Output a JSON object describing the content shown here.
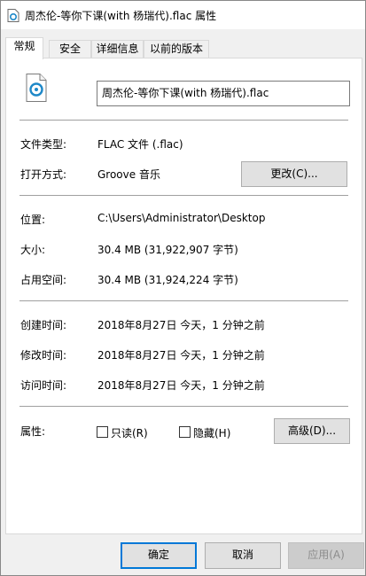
{
  "window": {
    "title": "周杰伦-等你下课(with 杨瑞代).flac 属性"
  },
  "tabs": [
    {
      "label": "常规"
    },
    {
      "label": "安全"
    },
    {
      "label": "详细信息"
    },
    {
      "label": "以前的版本"
    }
  ],
  "file": {
    "name": "周杰伦-等你下课(with 杨瑞代).flac",
    "icon": "music-file-icon"
  },
  "type": {
    "label": "文件类型:",
    "value": "FLAC 文件 (.flac)"
  },
  "open_with": {
    "label": "打开方式:",
    "value": "Groove 音乐",
    "button": "更改(C)..."
  },
  "location": {
    "label": "位置:",
    "value": "C:\\Users\\Administrator\\Desktop"
  },
  "size": {
    "label": "大小:",
    "value": "30.4 MB (31,922,907 字节)"
  },
  "size_on_disk": {
    "label": "占用空间:",
    "value": "30.4 MB (31,924,224 字节)"
  },
  "created": {
    "label": "创建时间:",
    "value": "2018年8月27日 今天，1 分钟之前"
  },
  "modified": {
    "label": "修改时间:",
    "value": "2018年8月27日 今天，1 分钟之前"
  },
  "accessed": {
    "label": "访问时间:",
    "value": "2018年8月27日 今天，1 分钟之前"
  },
  "attributes": {
    "label": "属性:",
    "readonly": "只读(R)",
    "hidden": "隐藏(H)",
    "advanced": "高级(D)..."
  },
  "footer": {
    "ok": "确定",
    "cancel": "取消",
    "apply": "应用(A)"
  },
  "colors": {
    "accent": "#0078d7",
    "icon_blue": "#1e88c8"
  }
}
